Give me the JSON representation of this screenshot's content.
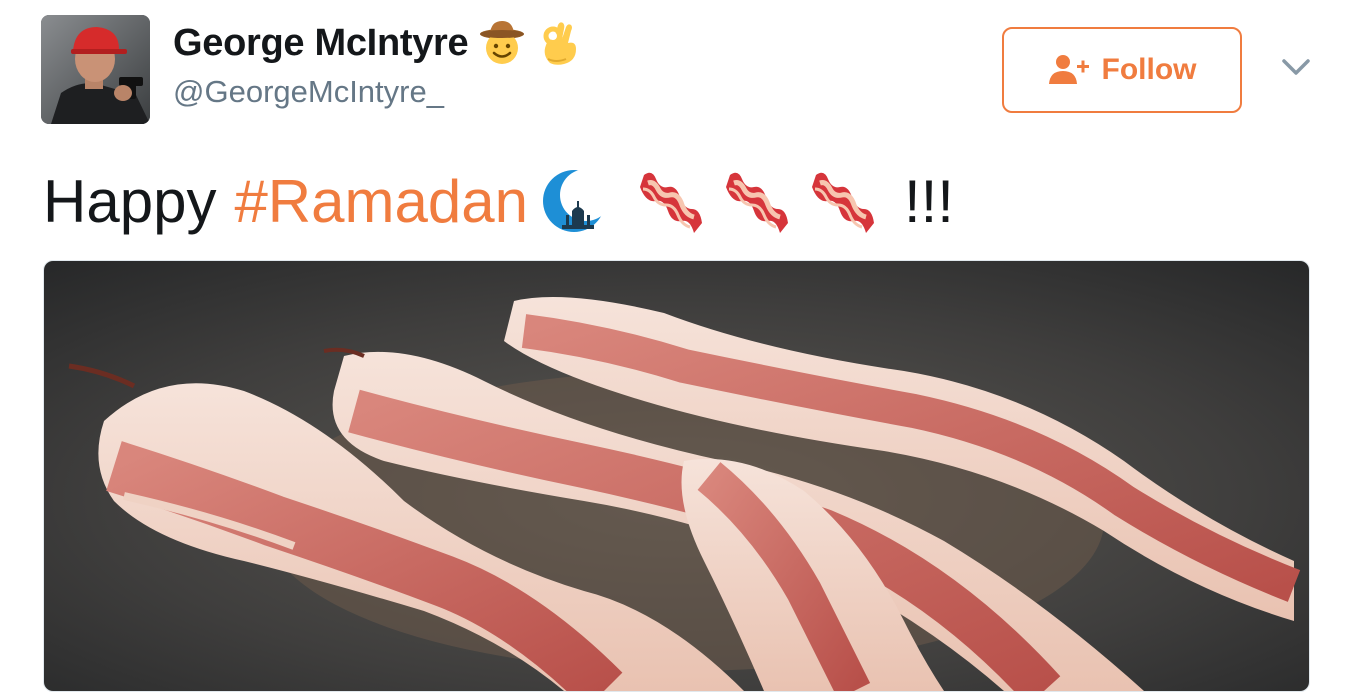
{
  "user": {
    "display_name": "George McIntyre",
    "handle": "@GeorgeMcIntyre_",
    "name_emojis": [
      "cowboy-face-icon",
      "ok-hand-icon"
    ]
  },
  "follow_button": {
    "label": "Follow",
    "icon": "add-person-icon"
  },
  "menu": {
    "icon": "chevron-down-icon"
  },
  "tweet": {
    "text_prefix": "Happy",
    "hashtag": "#Ramadan",
    "emojis": [
      "crescent-moon-mosque-icon",
      "bacon-icon",
      "bacon-icon",
      "bacon-icon"
    ],
    "text_suffix": "!!!"
  },
  "media": {
    "type": "photo",
    "subject": "bacon-in-pan"
  },
  "colors": {
    "accent": "#f07c3f",
    "text": "#14171a",
    "secondary": "#657786"
  }
}
